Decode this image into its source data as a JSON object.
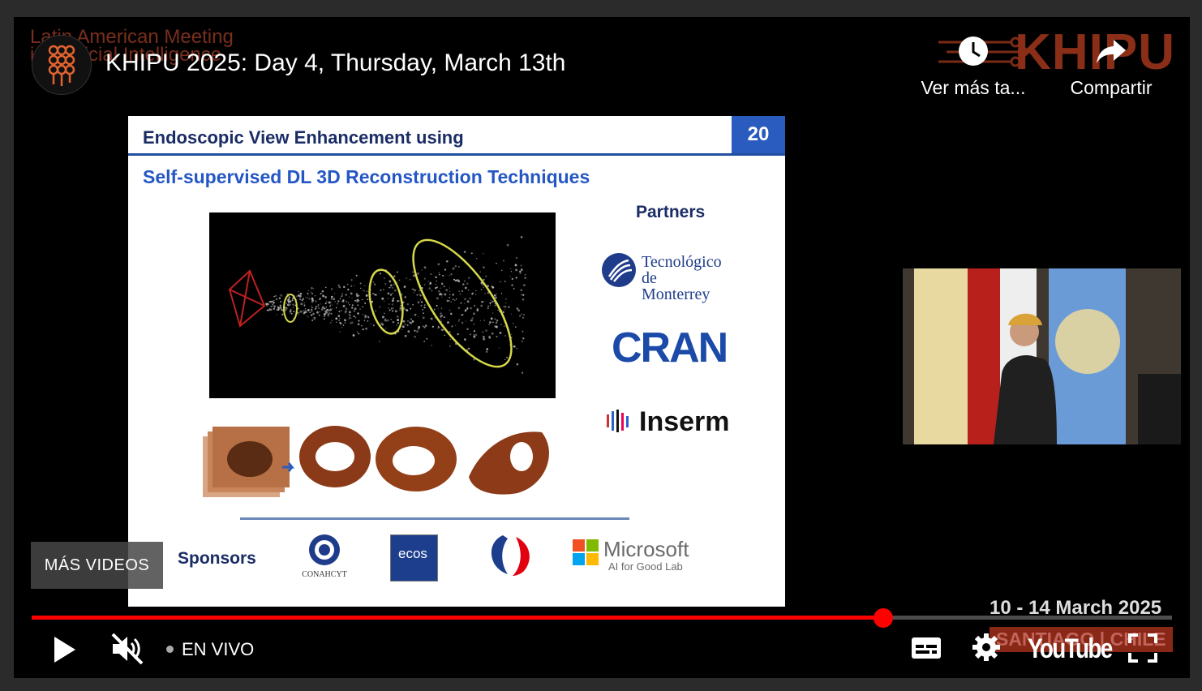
{
  "player": {
    "title": "KHIPU 2025: Day 4, Thursday, March 13th",
    "watch_later_label": "Ver más ta...",
    "share_label": "Compartir",
    "more_videos_label": "MÁS VIDEOS",
    "live_label": "EN VIVO",
    "progress_fraction": 0.747,
    "youtube_logo": "YouTube",
    "accent_color": "#ff0000",
    "icons": [
      "clock-icon",
      "share-arrow-icon",
      "play-icon",
      "muted-speaker-icon",
      "subtitles-icon",
      "gear-icon",
      "fullscreen-icon"
    ]
  },
  "background": {
    "meeting_line1": "Latin American Meeting",
    "meeting_line2": "in Artificial Intelligence",
    "brand": "KHIPU",
    "dates": "10 - 14 March 2025",
    "place": "SANTIAGO | CHILE",
    "brand_color": "#8a2e17"
  },
  "slide": {
    "title_line1": "Endoscopic View Enhancement using",
    "title_line2": "Self-supervised DL 3D Reconstruction Techniques",
    "number": "20",
    "partners_label": "Partners",
    "partner_tec_line1": "Tecnológico",
    "partner_tec_line2": "de Monterrey",
    "partner_cran": "CRAN",
    "partner_inserm": "Inserm",
    "sponsors_label": "Sponsors",
    "sponsor_conahcyt": "CONAHCYT",
    "sponsor_ecos": "ecos",
    "sponsor_ms": "Microsoft",
    "sponsor_ms_sub": "AI for Good Lab"
  }
}
